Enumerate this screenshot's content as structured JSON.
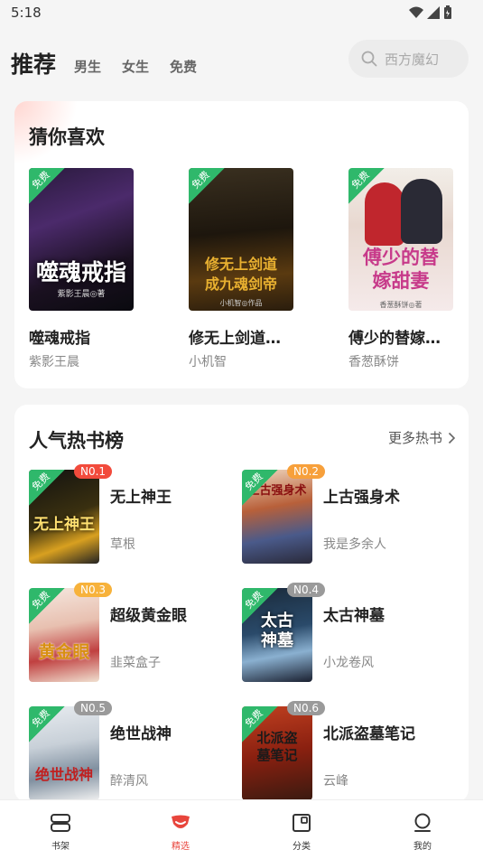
{
  "status": {
    "time": "5:18"
  },
  "nav": {
    "tabs": [
      "推荐",
      "男生",
      "女生",
      "免费"
    ],
    "search_placeholder": "西方魔幻"
  },
  "guess": {
    "title": "猜你喜欢",
    "free_label": "免费",
    "books": [
      {
        "title": "噬魂戒指",
        "author": "紫影王晨",
        "cover_text": "噬魂戒指",
        "cover_subtext": "紫影王晨◎著"
      },
      {
        "title": "修无上剑道…",
        "author": "小机智",
        "cover_text": "修无上剑道 成九魂剑帝",
        "cover_subtext": "小机智◎作品"
      },
      {
        "title": "傅少的替嫁…",
        "author": "香葱酥饼",
        "cover_text": "傅少的替嫁甜妻",
        "cover_subtext": "香葱酥饼◎著"
      }
    ]
  },
  "hot": {
    "title": "人气热书榜",
    "more": "更多热书",
    "free_label": "免费",
    "items": [
      {
        "rank": "N0.1",
        "title": "无上神王",
        "author": "草根",
        "cover_text": "无上神王",
        "rank_color": "#f24b3c"
      },
      {
        "rank": "N0.2",
        "title": "上古强身术",
        "author": "我是多余人",
        "cover_text": "上古强身术",
        "rank_color": "#f7a03b"
      },
      {
        "rank": "N0.3",
        "title": "超级黄金眼",
        "author": "韭菜盒子",
        "cover_text": "黄金眼",
        "rank_color": "#f7b23b"
      },
      {
        "rank": "N0.4",
        "title": "太古神墓",
        "author": "小龙卷风",
        "cover_text": "太古神墓",
        "rank_color": "#9a9a9a"
      },
      {
        "rank": "N0.5",
        "title": "绝世战神",
        "author": "醉清风",
        "cover_text": "绝世战神",
        "rank_color": "#9a9a9a"
      },
      {
        "rank": "N0.6",
        "title": "北派盗墓笔记",
        "author": "云峰",
        "cover_text": "北派盗墓笔记",
        "rank_color": "#9a9a9a"
      }
    ]
  },
  "bottom_nav": {
    "items": [
      {
        "label": "书架",
        "icon": "bookshelf-icon"
      },
      {
        "label": "精选",
        "icon": "featured-icon"
      },
      {
        "label": "分类",
        "icon": "category-icon"
      },
      {
        "label": "我的",
        "icon": "profile-icon"
      }
    ],
    "active_color": "#e8453c"
  }
}
